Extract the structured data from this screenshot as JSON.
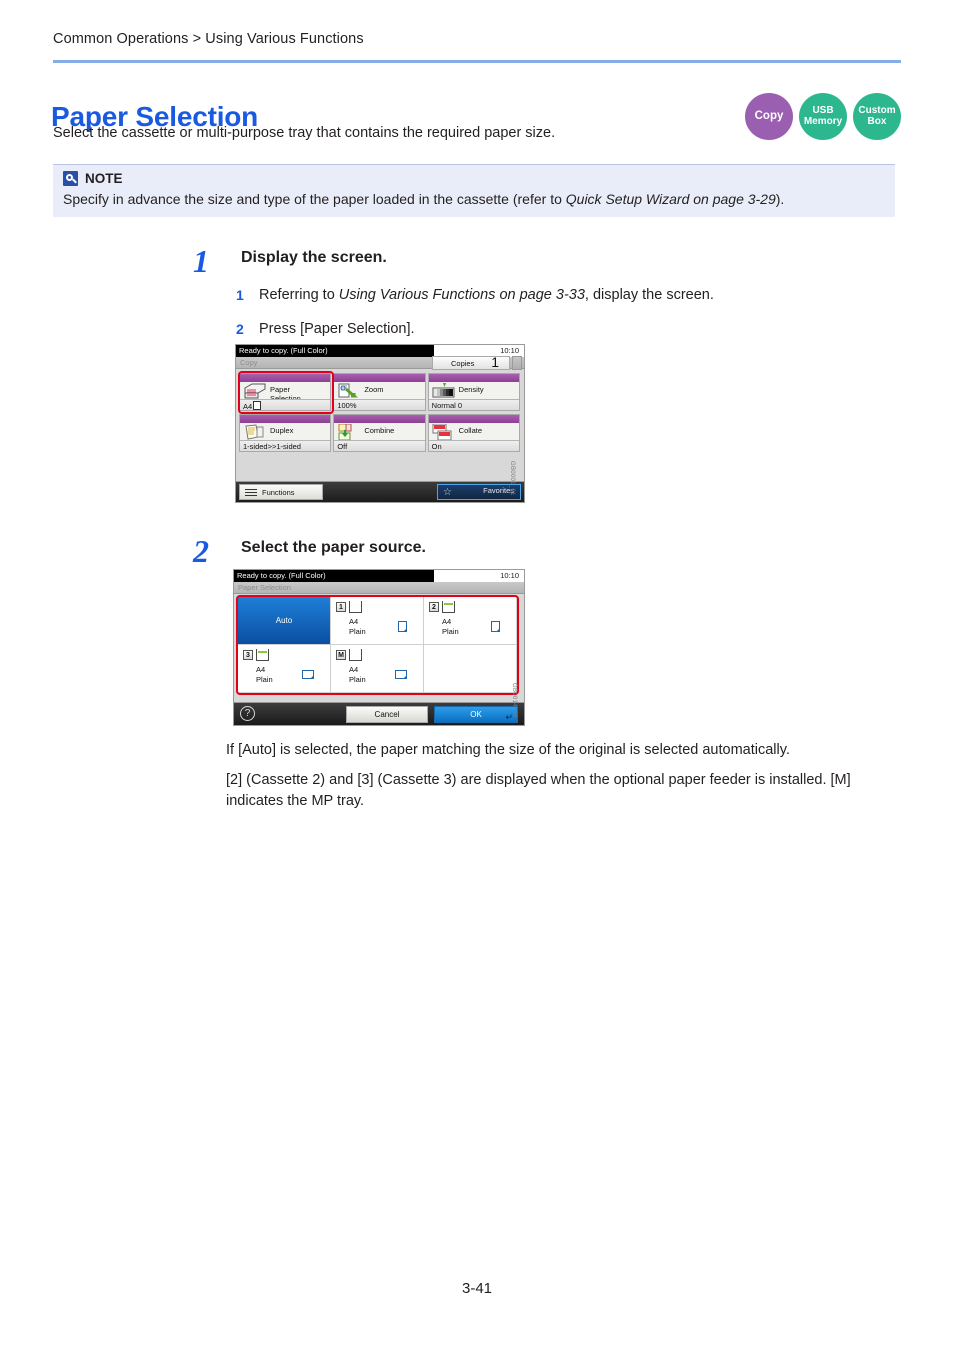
{
  "header": {
    "breadcrumb": "Common Operations > Using Various Functions"
  },
  "title": "Paper Selection",
  "subtitle": "Select the cassette or multi-purpose tray that contains the required paper size.",
  "badges": [
    {
      "name": "copy",
      "line1": "Copy",
      "line2": "",
      "color": "#9a5fb0"
    },
    {
      "name": "usb-memory",
      "line1": "USB",
      "line2": "Memory",
      "color": "#2db78e"
    },
    {
      "name": "custom-box",
      "line1": "Custom",
      "line2": "Box",
      "color": "#2db78e"
    }
  ],
  "note": {
    "title": "NOTE",
    "text_before": "Specify in advance the size and type of the paper loaded in the cassette (refer to ",
    "text_italic": "Quick Setup Wizard on page 3-29",
    "text_after": ")."
  },
  "steps": [
    {
      "number": "1",
      "title": "Display the screen.",
      "substeps": [
        {
          "number": "1",
          "text_before": "Referring to ",
          "text_italic": "Using Various Functions on page 3-33",
          "text_after": ", display the screen."
        },
        {
          "number": "2",
          "text_before": "Press [Paper Selection].",
          "text_italic": "",
          "text_after": ""
        }
      ]
    },
    {
      "number": "2",
      "title": "Select the paper source."
    }
  ],
  "copy_screen": {
    "status_message": "Ready to copy. (Full Color)",
    "clock": "10:10",
    "tab_name": "Copy",
    "copies_label": "Copies",
    "copies_value": "1",
    "functions": [
      {
        "name": "Paper\nSelection",
        "value": "A4",
        "icon": "cassette-icon",
        "has_size_glyph": true
      },
      {
        "name": "Zoom",
        "value": "100%",
        "icon": "zoom-icon",
        "has_size_glyph": false
      },
      {
        "name": "Density",
        "value": "Normal 0",
        "icon": "density-icon",
        "has_size_glyph": false
      },
      {
        "name": "Duplex",
        "value": "1-sided>>1-sided",
        "icon": "duplex-icon",
        "has_size_glyph": false
      },
      {
        "name": "Combine",
        "value": "Off",
        "icon": "combine-icon",
        "has_size_glyph": false
      },
      {
        "name": "Collate",
        "value": "On",
        "icon": "collate-icon",
        "has_size_glyph": false
      }
    ],
    "functions_button": "Functions",
    "favorites_button": "Favorites",
    "code_tag": "GB0001_01"
  },
  "paper_selection_screen": {
    "status_message": "Ready to copy. (Full Color)",
    "clock": "10:10",
    "tab_name": "Paper Selection",
    "sources": [
      {
        "tag": "",
        "label": "Auto",
        "size": "",
        "type": "",
        "selected": true,
        "orientation": ""
      },
      {
        "tag": "1",
        "label": "",
        "size": "A4",
        "type": "Plain",
        "selected": false,
        "orientation": "portrait",
        "tray_filled": false
      },
      {
        "tag": "2",
        "label": "",
        "size": "A4",
        "type": "Plain",
        "selected": false,
        "orientation": "portrait",
        "tray_filled": true
      },
      {
        "tag": "3",
        "label": "",
        "size": "A4",
        "type": "Plain",
        "selected": false,
        "orientation": "landscape",
        "tray_filled": true
      },
      {
        "tag": "M",
        "label": "",
        "size": "A4",
        "type": "Plain",
        "selected": false,
        "orientation": "landscape",
        "tray_filled": false
      }
    ],
    "help_icon": "?",
    "cancel_button": "Cancel",
    "ok_button": "OK",
    "code_tag": "GB0014_00"
  },
  "body_paragraphs": [
    "If [Auto] is selected, the paper matching the size of the original is selected automatically.",
    "[2] (Cassette 2) and [3] (Cassette 3) are displayed when the optional paper feeder is installed. [M] indicates the MP tray."
  ],
  "page_number": "3-41"
}
